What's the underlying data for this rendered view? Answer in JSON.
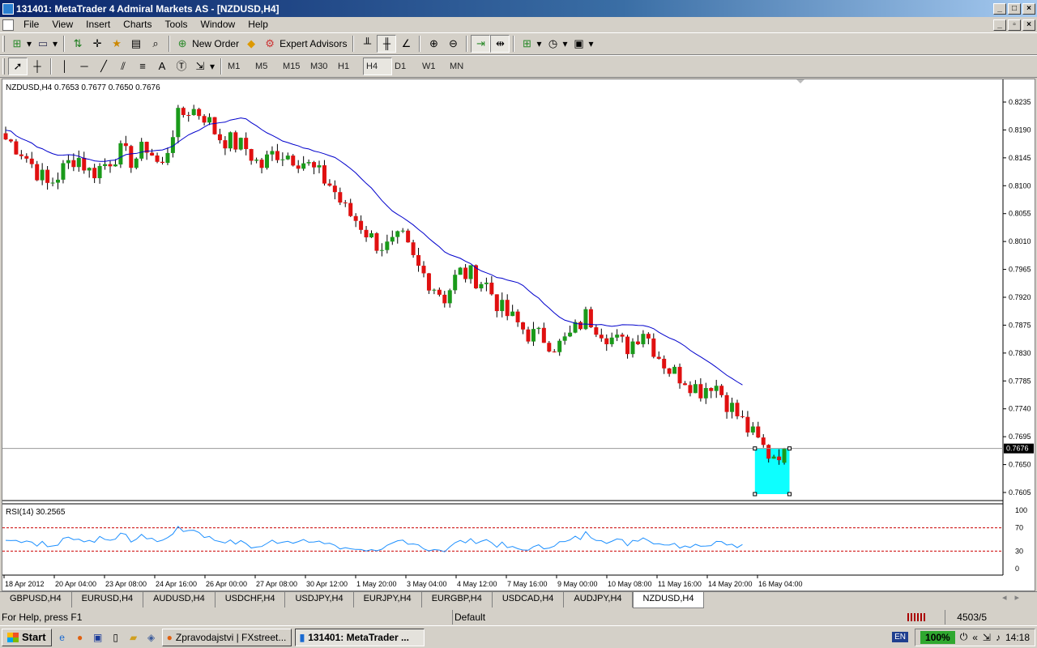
{
  "window": {
    "title": "131401: MetaTrader 4 Admiral Markets AS - [NZDUSD,H4]"
  },
  "menu": [
    "File",
    "View",
    "Insert",
    "Charts",
    "Tools",
    "Window",
    "Help"
  ],
  "toolbar": {
    "new_order": "New Order",
    "expert_advisors": "Expert Advisors"
  },
  "timeframes": [
    "M1",
    "M5",
    "M15",
    "M30",
    "H1",
    "H4",
    "D1",
    "W1",
    "MN"
  ],
  "active_timeframe": "H4",
  "chart": {
    "header": "NZDUSD,H4  0.7653 0.7677 0.7650 0.7676",
    "price_ticks": [
      "0.8235",
      "0.8190",
      "0.8145",
      "0.8100",
      "0.8055",
      "0.8010",
      "0.7965",
      "0.7920",
      "0.7875",
      "0.7830",
      "0.7785",
      "0.7740",
      "0.7695",
      "0.7650",
      "0.7605"
    ],
    "current_price": "0.7676",
    "rsi_header": "RSI(14) 30.2565",
    "rsi_ticks": [
      "100",
      "70",
      "30",
      "0"
    ],
    "time_ticks": [
      "18 Apr 2012",
      "20 Apr 04:00",
      "23 Apr 08:00",
      "24 Apr 16:00",
      "26 Apr 00:00",
      "27 Apr 08:00",
      "30 Apr 12:00",
      "1 May 20:00",
      "3 May 04:00",
      "4 May 12:00",
      "7 May 16:00",
      "9 May 00:00",
      "10 May 08:00",
      "11 May 16:00",
      "14 May 20:00",
      "16 May 04:00"
    ],
    "colors": {
      "bull": "#1a9a1a",
      "bear": "#e01010",
      "ma": "#0000cc",
      "rsi": "#1e90ff",
      "level": "#cc0000",
      "highlight": "#00ffff"
    }
  },
  "chart_data": {
    "type": "candlestick",
    "symbol": "NZDUSD",
    "timeframe": "H4",
    "ylim": [
      0.7605,
      0.8235
    ],
    "last_ohlc": [
      0.7653,
      0.7677,
      0.765,
      0.7676
    ],
    "close_path": [
      0.8175,
      0.816,
      0.813,
      0.81,
      0.8125,
      0.815,
      0.812,
      0.8135,
      0.8155,
      0.814,
      0.8165,
      0.8125,
      0.8205,
      0.8225,
      0.8215,
      0.818,
      0.817,
      0.816,
      0.813,
      0.8155,
      0.815,
      0.814,
      0.812,
      0.81,
      0.806,
      0.804,
      0.801,
      0.8,
      0.8015,
      0.797,
      0.7945,
      0.792,
      0.796,
      0.7955,
      0.794,
      0.79,
      0.788,
      0.786,
      0.7855,
      0.784,
      0.786,
      0.789,
      0.787,
      0.785,
      0.784,
      0.787,
      0.783,
      0.78,
      0.779,
      0.777,
      0.7785,
      0.775,
      0.772,
      0.769,
      0.7665,
      0.7676
    ],
    "ma_period_shown": "moving average line (blue)",
    "rsi": {
      "period": 14,
      "last": 30.2565,
      "levels": [
        70,
        30
      ],
      "ylim": [
        0,
        100
      ]
    }
  },
  "tabs": [
    "GBPUSD,H4",
    "EURUSD,H4",
    "AUDUSD,H4",
    "USDCHF,H4",
    "USDJPY,H4",
    "EURJPY,H4",
    "EURGBP,H4",
    "USDCAD,H4",
    "AUDJPY,H4",
    "NZDUSD,H4"
  ],
  "active_tab": "NZDUSD,H4",
  "status": {
    "help": "For Help, press F1",
    "profile": "Default",
    "traffic": "4503/5 kb"
  },
  "taskbar": {
    "start": "Start",
    "tasks": [
      "Zpravodajstvi | FXstreet...",
      "131401: MetaTrader ..."
    ],
    "active_task": "131401: MetaTrader ...",
    "lang": "EN",
    "battery": "100%",
    "clock": "14:18",
    "chevrons": "«"
  }
}
